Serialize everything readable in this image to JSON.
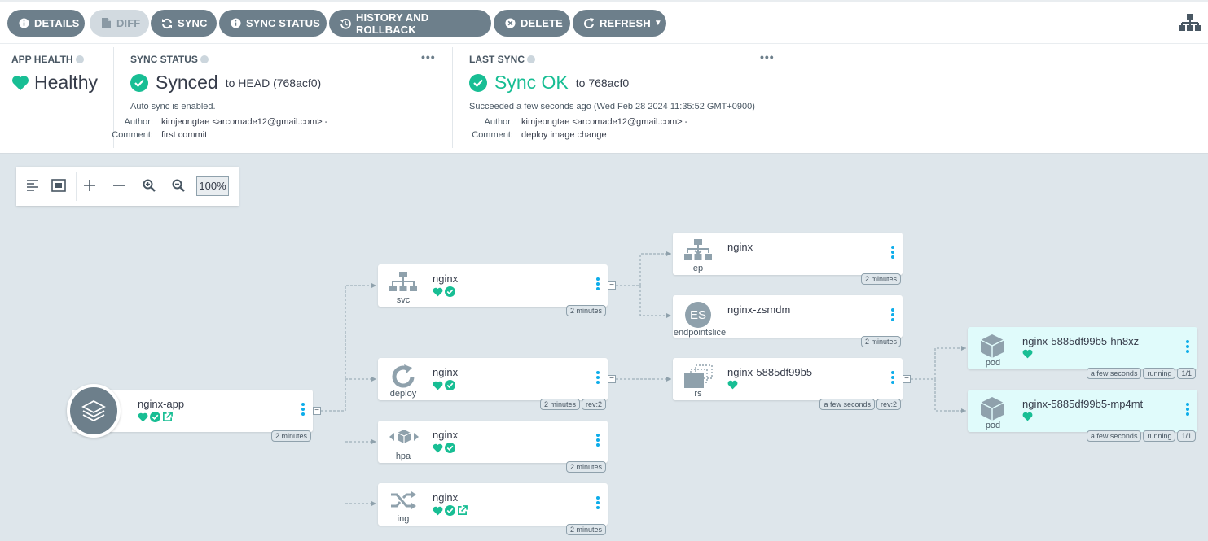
{
  "toolbar": {
    "details": "DETAILS",
    "diff": "DIFF",
    "sync": "SYNC",
    "sync_status": "SYNC STATUS",
    "history": "HISTORY AND ROLLBACK",
    "delete": "DELETE",
    "refresh": "REFRESH"
  },
  "app_health": {
    "title": "APP HEALTH",
    "value": "Healthy"
  },
  "sync_status": {
    "title": "SYNC STATUS",
    "value": "Synced",
    "to": "to HEAD (768acf0)",
    "auto": "Auto sync is enabled.",
    "author_label": "Author:",
    "author": "kimjeongtae <arcomade12@gmail.com> -",
    "comment_label": "Comment:",
    "comment": "first commit",
    "more": "•••"
  },
  "last_sync": {
    "title": "LAST SYNC",
    "value": "Sync OK",
    "to": "to 768acf0",
    "when": "Succeeded a few seconds ago (Wed Feb 28 2024 11:35:52 GMT+0900)",
    "author_label": "Author:",
    "author": "kimjeongtae <arcomade12@gmail.com> -",
    "comment_label": "Comment:",
    "comment": "deploy image change",
    "more": "•••"
  },
  "graph": {
    "zoom": "100%",
    "app": {
      "name": "nginx-app",
      "age": "2 minutes"
    },
    "nodes": {
      "svc": {
        "kind": "svc",
        "name": "nginx",
        "age": "2 minutes"
      },
      "deploy": {
        "kind": "deploy",
        "name": "nginx",
        "age": "2 minutes",
        "rev": "rev:2"
      },
      "hpa": {
        "kind": "hpa",
        "name": "nginx",
        "age": "2 minutes"
      },
      "ing": {
        "kind": "ing",
        "name": "nginx",
        "age": "2 minutes"
      },
      "ep": {
        "kind": "ep",
        "name": "nginx",
        "age": "2 minutes"
      },
      "es": {
        "kind": "endpointslice",
        "badge": "ES",
        "name": "nginx-zsmdm",
        "age": "2 minutes"
      },
      "rs": {
        "kind": "rs",
        "name": "nginx-5885df99b5",
        "age": "a few seconds",
        "rev": "rev:2"
      },
      "pod1": {
        "kind": "pod",
        "name": "nginx-5885df99b5-hn8xz",
        "age": "a few seconds",
        "state": "running",
        "ready": "1/1"
      },
      "pod2": {
        "kind": "pod",
        "name": "nginx-5885df99b5-mp4mt",
        "age": "a few seconds",
        "state": "running",
        "ready": "1/1"
      }
    }
  },
  "colors": {
    "button": "#6d7f8b",
    "healthy": "#18be94",
    "menu_dots": "#0dadea",
    "pod_bg": "#e0fbfb",
    "canvas": "#dee6eb"
  }
}
